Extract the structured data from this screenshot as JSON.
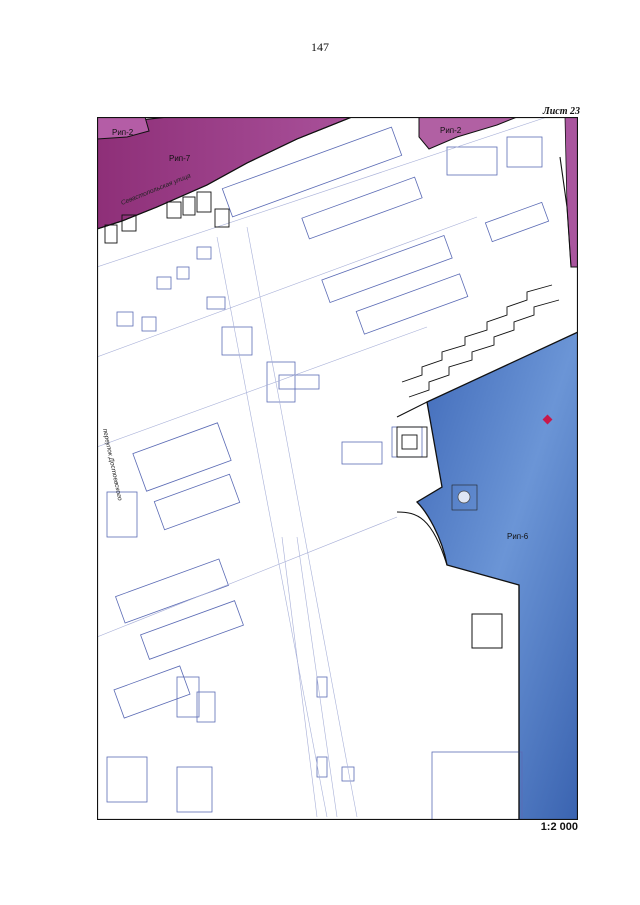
{
  "page": {
    "number": "147",
    "sheet": "Лист 23",
    "scale": "1:2 000"
  },
  "map": {
    "zones": [
      {
        "label": "Рип-2"
      },
      {
        "label": "Рип-7"
      },
      {
        "label": "Рип-2"
      },
      {
        "label": "Рип-6"
      }
    ],
    "streets": [
      {
        "label": "Севастопольская улица"
      },
      {
        "label": "переулок Достоевского"
      }
    ],
    "colors": {
      "zone_purple": "#9a3d85",
      "zone_blue": "#4b78c6",
      "building_outline": "#5b6bb5",
      "boundary": "#111111",
      "marker": "#c8184a"
    }
  }
}
